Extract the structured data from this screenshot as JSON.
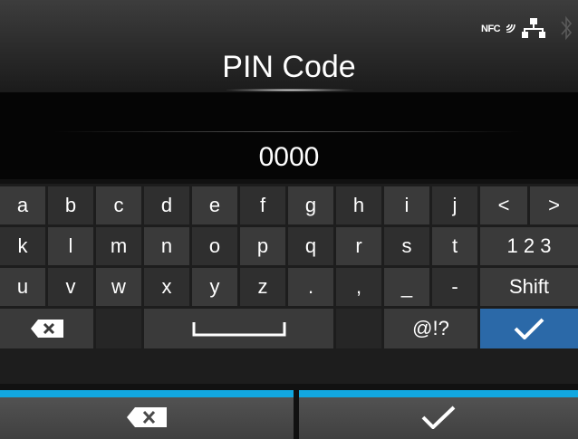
{
  "header": {
    "title": "PIN Code",
    "nfc_label": "NFC"
  },
  "field": {
    "value": "0000"
  },
  "keyboard": {
    "row1": [
      "a",
      "b",
      "c",
      "d",
      "e",
      "f",
      "g",
      "h",
      "i",
      "j",
      "<",
      ">"
    ],
    "row2": [
      "k",
      "l",
      "m",
      "n",
      "o",
      "p",
      "q",
      "r",
      "s",
      "t",
      "1 2 3"
    ],
    "row3": [
      "u",
      "v",
      "w",
      "x",
      "y",
      "z",
      ".",
      ",",
      "_",
      "-",
      "Shift"
    ],
    "row4": {
      "symbols": "@!?"
    }
  },
  "icons": {
    "status": [
      "nfc-icon",
      "network-icon",
      "bluetooth-icon"
    ],
    "keys": [
      "backspace-icon",
      "space-icon",
      "checkmark-icon"
    ],
    "bottom": [
      "backspace-icon",
      "checkmark-icon"
    ]
  },
  "colors": {
    "accent": "#12a7e0",
    "ok_key": "#2b69a8"
  }
}
